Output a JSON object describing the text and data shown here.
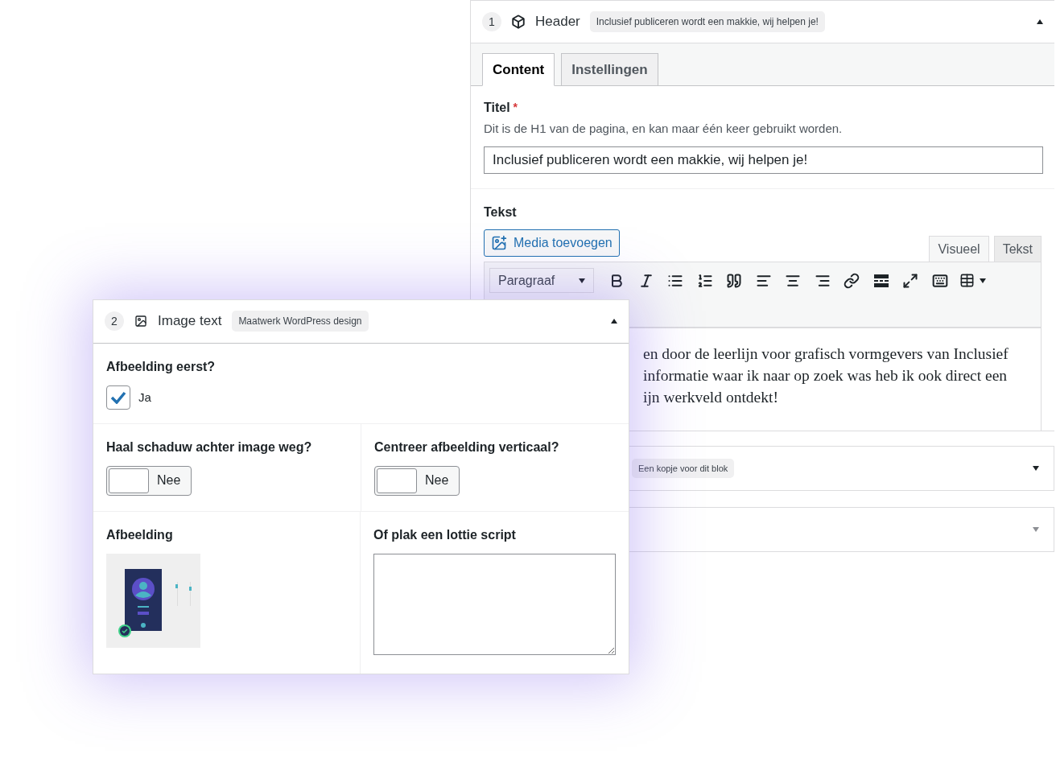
{
  "header_block": {
    "number": "1",
    "title": "Header",
    "tag": "Inclusief publiceren wordt een makkie, wij helpen je!",
    "expanded": true,
    "tabs": [
      {
        "label": "Content",
        "selected": true
      },
      {
        "label": "Instellingen",
        "selected": false
      }
    ],
    "title_field": {
      "label": "Titel",
      "required_mark": "*",
      "description": "Dit is de H1 van de pagina, en kan maar één keer gebruikt worden.",
      "value": "Inclusief publiceren wordt een makkie, wij helpen je!"
    },
    "text_field": {
      "label": "Tekst",
      "media_button": "Media toevoegen",
      "editor_tabs": [
        {
          "label": "Visueel",
          "selected": true
        },
        {
          "label": "Tekst",
          "selected": false
        }
      ],
      "format_select": "Paragraaf",
      "content_lines": [
        "en door de leerlijn voor grafisch vormgevers van Inclusief",
        "informatie waar ik naar op zoek was heb ik ook direct een",
        "ijn werkveld ontdekt!"
      ]
    }
  },
  "collapsed_blocks": [
    {
      "tag": "Een kopje voor dit blok",
      "expanded": false
    },
    {
      "expanded": false
    }
  ],
  "image_text_block": {
    "number": "2",
    "title": "Image text",
    "tag": "Maatwerk WordPress design",
    "expanded": true,
    "first_field": {
      "label": "Afbeelding eerst?",
      "checkbox": {
        "label": "Ja",
        "checked": true
      }
    },
    "toggles": [
      {
        "label": "Haal schaduw achter image weg?",
        "value": "Nee",
        "on": false
      },
      {
        "label": "Centreer afbeelding verticaal?",
        "value": "Nee",
        "on": false
      }
    ],
    "image_field": {
      "label": "Afbeelding"
    },
    "lottie_field": {
      "label": "Of plak een lottie script"
    }
  }
}
